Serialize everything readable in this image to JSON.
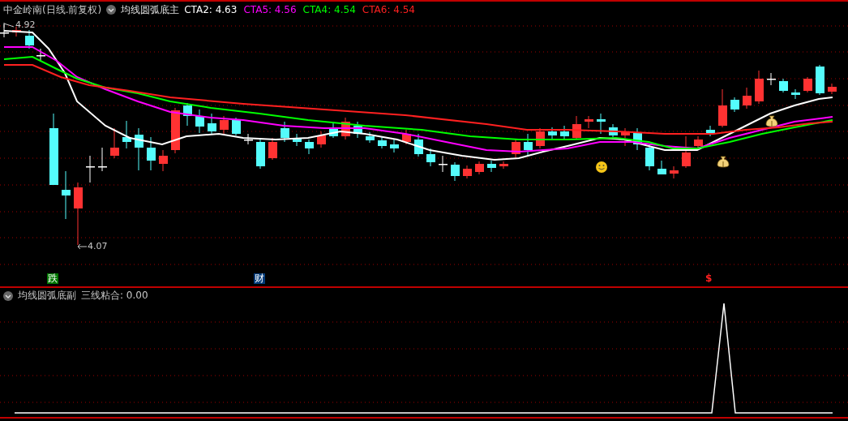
{
  "main_pane": {
    "security": "中金岭南(日线.前复权)",
    "indicator": "均线圆弧底主",
    "legend": [
      {
        "label": "CTA2: 4.63",
        "color": "#ffffff"
      },
      {
        "label": "CTA5: 4.56",
        "color": "#ff00ff"
      },
      {
        "label": "CTA4: 4.54",
        "color": "#00ff00"
      },
      {
        "label": "CTA6: 4.54",
        "color": "#ff2020"
      }
    ],
    "high_label": "4.92",
    "low_label": "4.07",
    "signals": [
      {
        "text": "跌",
        "kind": "tag",
        "color": "#007700"
      },
      {
        "text": "财",
        "kind": "tag",
        "color": "#003a78"
      },
      {
        "text": "$",
        "kind": "glyph",
        "color": "#ff2020"
      }
    ]
  },
  "sub_pane": {
    "indicator": "均线圆弧底副",
    "reading": "三线粘合: 0.00"
  }
}
